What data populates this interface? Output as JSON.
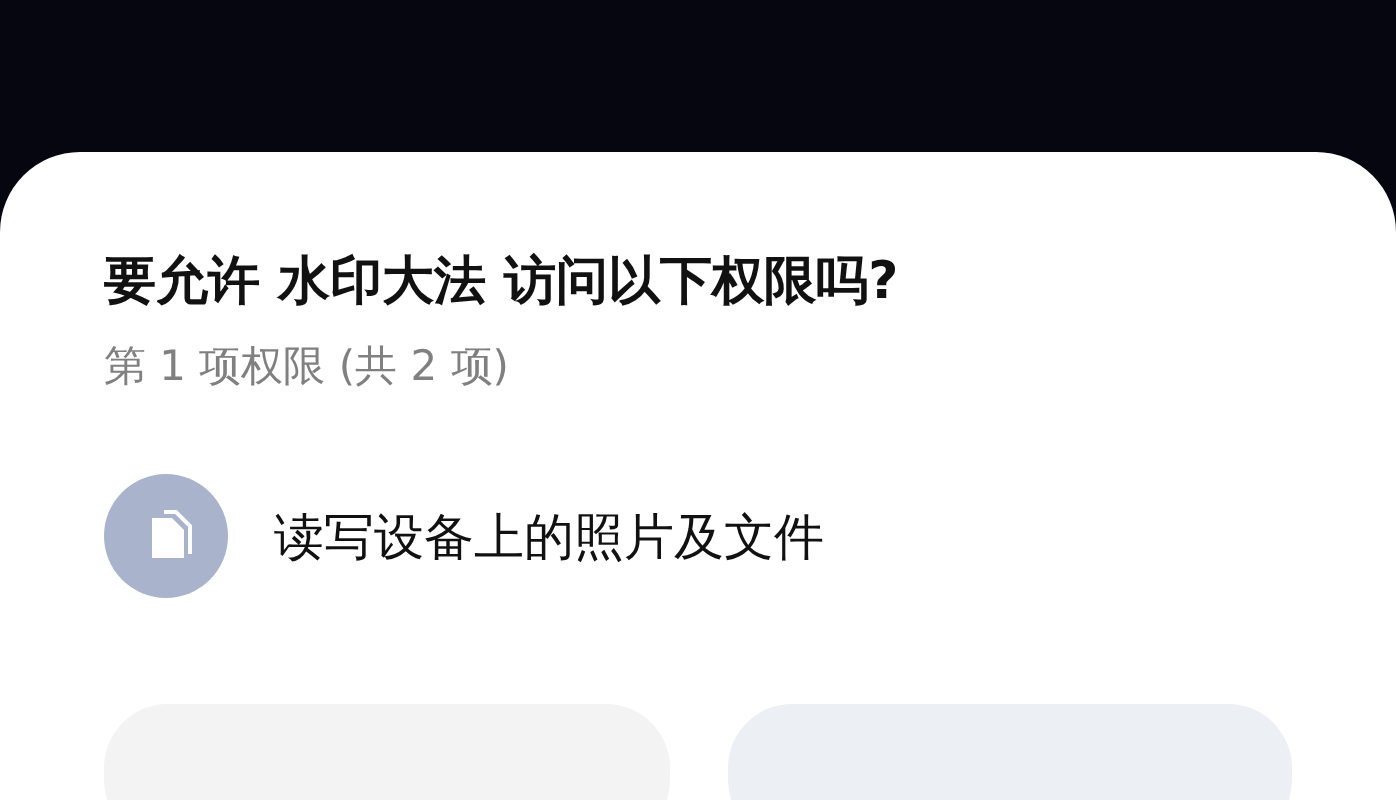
{
  "dialog": {
    "title": "要允许 水印大法 访问以下权限吗?",
    "subtitle": "第 1 项权限 (共 2 项)",
    "permission": {
      "label": "读写设备上的照片及文件"
    },
    "buttons": [
      {
        "kind": "deny"
      },
      {
        "kind": "allow"
      }
    ]
  }
}
